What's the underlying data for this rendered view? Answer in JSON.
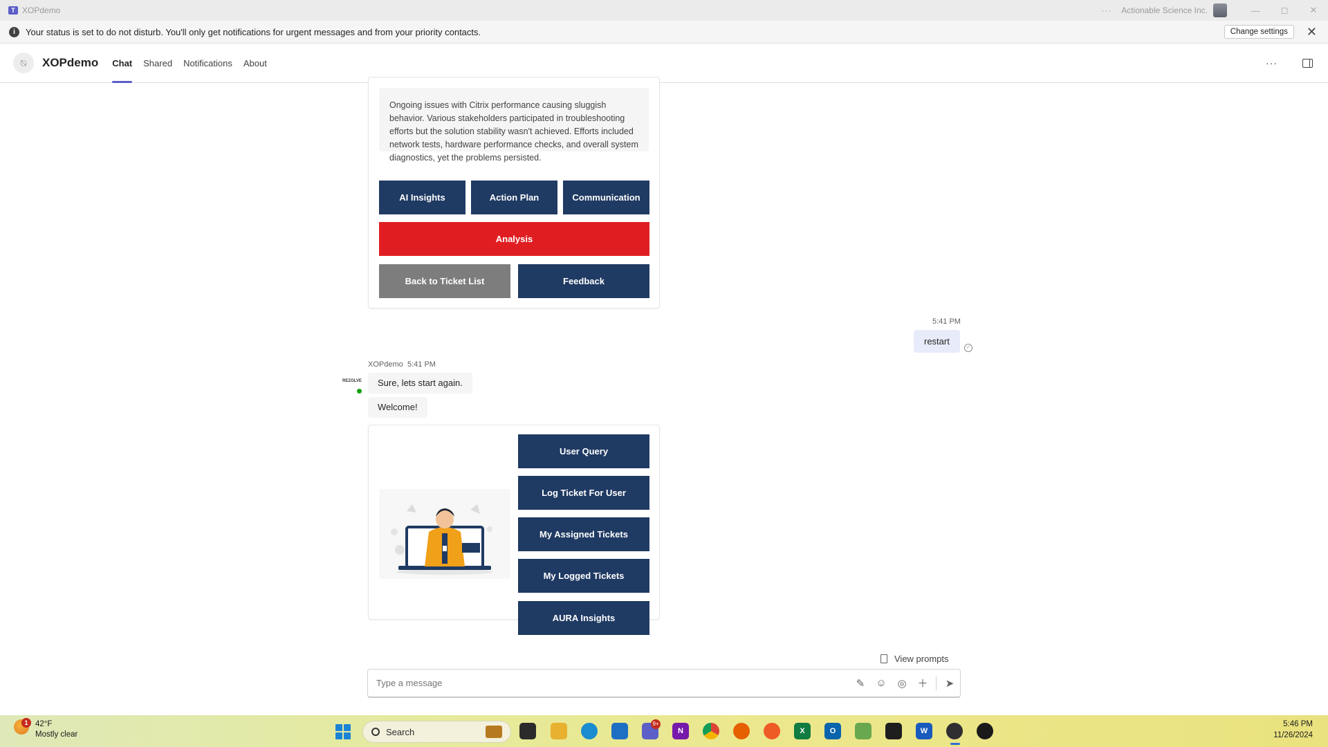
{
  "window": {
    "app_name": "XOPdemo",
    "org": "Actionable Science Inc.",
    "controls": {
      "more": "···",
      "minimize": "—",
      "maximize": "◻",
      "close": "✕"
    }
  },
  "notice": {
    "message": "Your status is set to do not disturb. You'll only get notifications for urgent messages and from your priority contacts.",
    "change_settings": "Change settings",
    "close": "✕"
  },
  "header": {
    "title": "XOPdemo",
    "tabs": [
      {
        "label": "Chat",
        "active": true
      },
      {
        "label": "Shared",
        "active": false
      },
      {
        "label": "Notifications",
        "active": false
      },
      {
        "label": "About",
        "active": false
      }
    ],
    "more": "···"
  },
  "card1": {
    "summary": "Ongoing issues with Citrix performance causing sluggish behavior. Various stakeholders participated in troubleshooting efforts but the solution stability wasn't achieved. Efforts included network tests, hardware performance checks, and overall system diagnostics, yet the problems persisted.",
    "buttons": {
      "ai_insights": "AI Insights",
      "action_plan": "Action Plan",
      "communication": "Communication",
      "analysis": "Analysis",
      "back": "Back to Ticket List",
      "feedback": "Feedback"
    }
  },
  "my_message": {
    "time": "5:41 PM",
    "text": "restart"
  },
  "bot_message": {
    "sender": "XOPdemo",
    "time": "5:41 PM",
    "avatar_text": "REZOLVE",
    "lines": [
      "Sure, lets start again.",
      "Welcome!"
    ]
  },
  "card2": {
    "buttons": [
      "User Query",
      "Log Ticket For User",
      "My Assigned Tickets",
      "My Logged Tickets",
      "AURA Insights"
    ]
  },
  "compose": {
    "view_prompts": "View prompts",
    "placeholder": "Type a message"
  },
  "taskbar": {
    "weather_badge": "1",
    "temperature": "42°F",
    "condition": "Mostly clear",
    "search": "Search",
    "teams_badge": "9+",
    "time": "5:46 PM",
    "date": "11/26/2024"
  },
  "colors": {
    "navy": "#1f3a63",
    "red": "#e01e22",
    "gray": "#7d7d7d",
    "accent": "#5b5fc7"
  }
}
